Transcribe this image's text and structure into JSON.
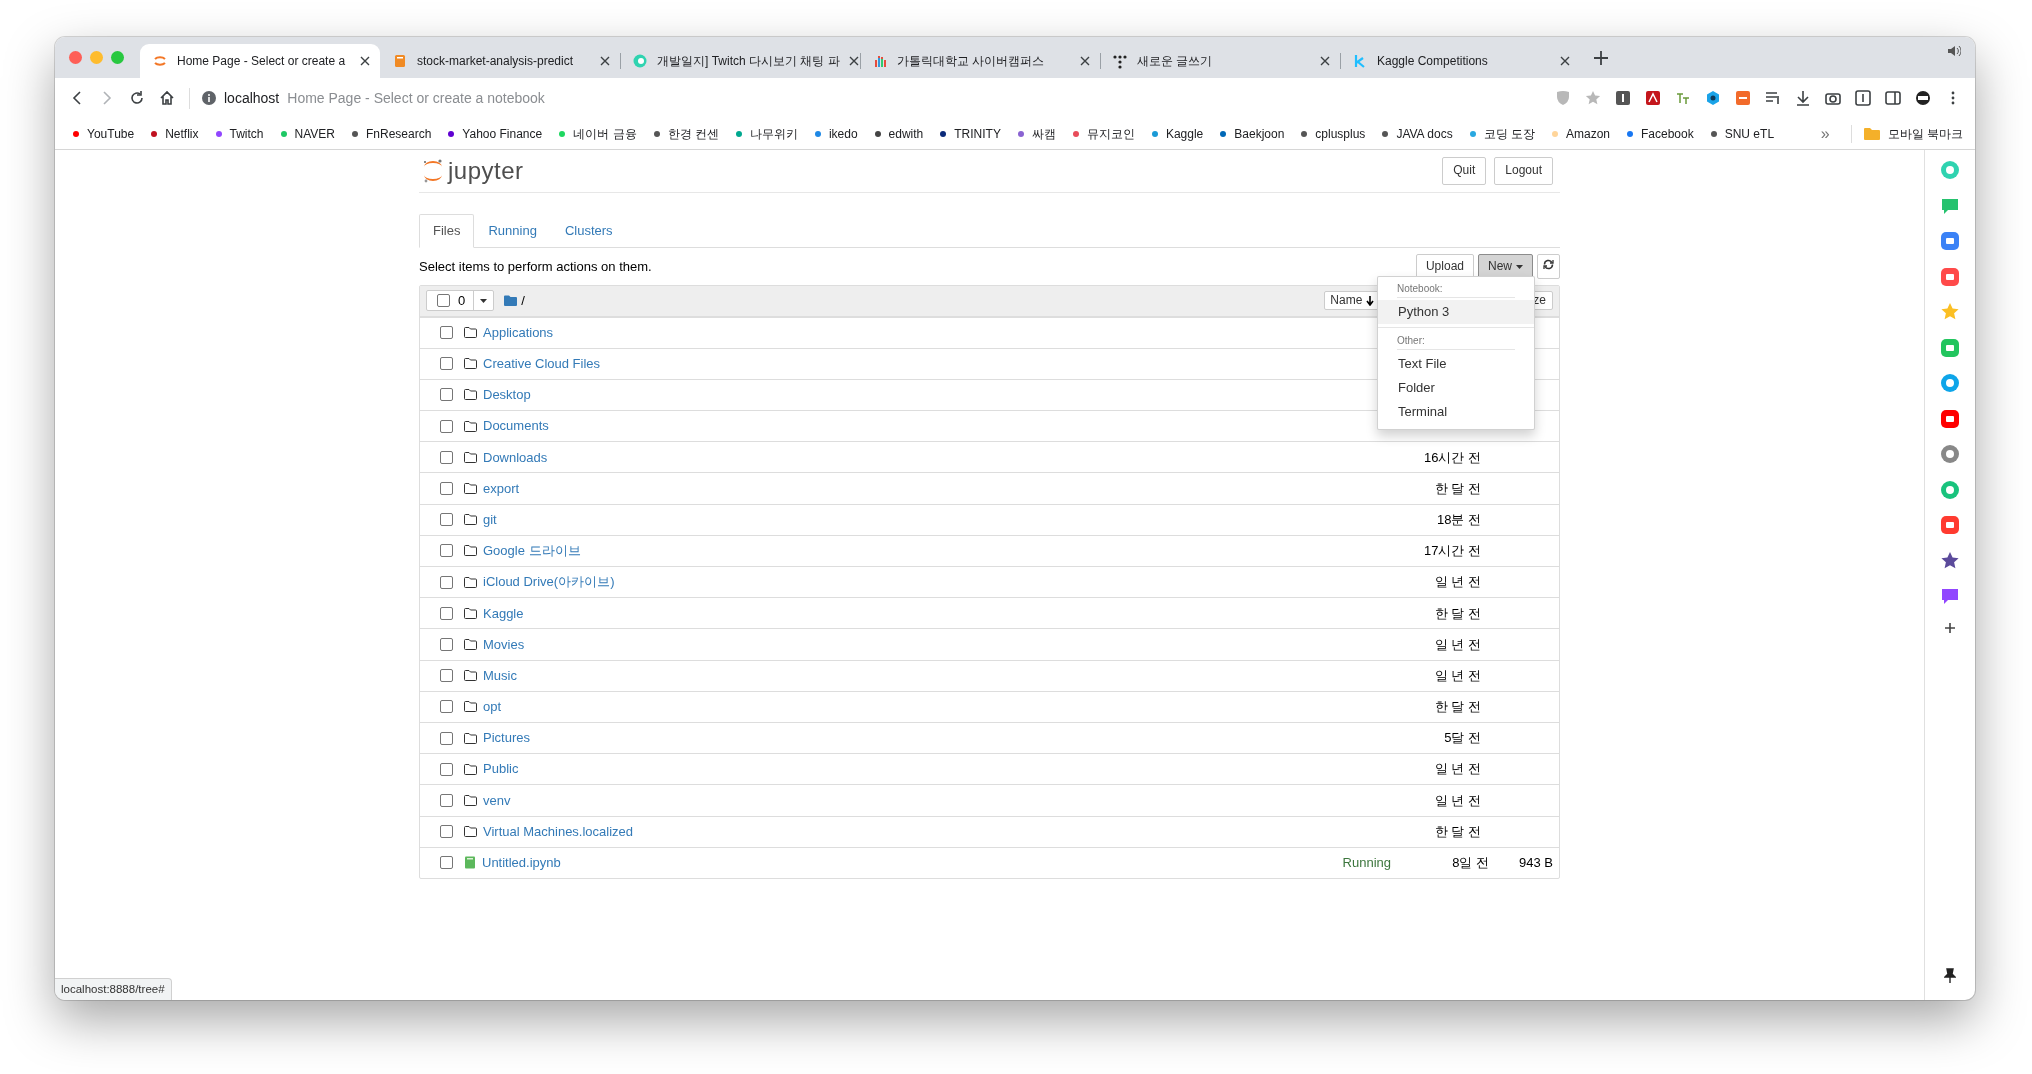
{
  "browser": {
    "tabs": [
      {
        "title": "Home Page - Select or create a",
        "selected": true
      },
      {
        "title": "stock-market-analysis-predict",
        "selected": false
      },
      {
        "title": "개발일지] Twitch 다시보기 채팅 파",
        "selected": false
      },
      {
        "title": "가톨릭대학교 사이버캠퍼스",
        "selected": false
      },
      {
        "title": "새로운 글쓰기",
        "selected": false
      },
      {
        "title": "Kaggle Competitions",
        "selected": false
      }
    ],
    "address": {
      "host": "localhost",
      "page_title": "Home Page - Select or create a notebook"
    },
    "bookmarks": [
      {
        "label": "YouTube",
        "color": "#ff0000"
      },
      {
        "label": "Netflix",
        "color": "#c0111f"
      },
      {
        "label": "Twitch",
        "color": "#9146ff"
      },
      {
        "label": "NAVER",
        "color": "#1ec865"
      },
      {
        "label": "FnResearch",
        "color": "#555555"
      },
      {
        "label": "Yahoo Finance",
        "color": "#6001d2"
      },
      {
        "label": "네이버 금융",
        "color": "#1ed760"
      },
      {
        "label": "한경 컨센",
        "color": "#555555"
      },
      {
        "label": "나무위키",
        "color": "#00a88f"
      },
      {
        "label": "ikedo",
        "color": "#1e88e5"
      },
      {
        "label": "edwith",
        "color": "#444444"
      },
      {
        "label": "TRINITY",
        "color": "#0b2a7a"
      },
      {
        "label": "싸캠",
        "color": "#8a63d2"
      },
      {
        "label": "뮤지코인",
        "color": "#e84c5a"
      },
      {
        "label": "Kaggle",
        "color": "#1a9ad6"
      },
      {
        "label": "Baekjoon",
        "color": "#0068b7"
      },
      {
        "label": "cplusplus",
        "color": "#555555"
      },
      {
        "label": "JAVA docs",
        "color": "#555555"
      },
      {
        "label": "코딩 도장",
        "color": "#29a8e0"
      },
      {
        "label": "Amazon",
        "color": "#ffd59a"
      },
      {
        "label": "Facebook",
        "color": "#1877f2"
      },
      {
        "label": "SNU eTL",
        "color": "#555555"
      }
    ],
    "bookmark_overflow": "»",
    "bookmark_folder": "모바일 북마크"
  },
  "jupyter": {
    "logo_text": "jupyter",
    "header_buttons": [
      "Quit",
      "Logout"
    ],
    "tabs": [
      {
        "label": "Files",
        "selected": true
      },
      {
        "label": "Running",
        "selected": false
      },
      {
        "label": "Clusters",
        "selected": false
      }
    ],
    "hint": "Select items to perform actions on them.",
    "upload_button": "Upload",
    "new_button": "New",
    "selection_count": "0",
    "path": "/",
    "sort_button": "Name",
    "column_3": "ze",
    "rows": [
      {
        "name": "Applications",
        "kind": "folder",
        "checked": false
      },
      {
        "name": "Creative Cloud Files",
        "kind": "folder",
        "checked": false
      },
      {
        "name": "Desktop",
        "kind": "folder",
        "checked": false
      },
      {
        "name": "Documents",
        "kind": "folder",
        "checked": false
      },
      {
        "name": "Downloads",
        "kind": "folder",
        "checked": false,
        "modified": "16시간 전"
      },
      {
        "name": "export",
        "kind": "folder",
        "checked": false,
        "modified": "한 달 전"
      },
      {
        "name": "git",
        "kind": "folder",
        "checked": false,
        "modified": "18분 전"
      },
      {
        "name": "Google 드라이브",
        "kind": "folder",
        "checked": false,
        "modified": "17시간 전"
      },
      {
        "name": "iCloud Drive(아카이브)",
        "kind": "folder",
        "checked": false,
        "modified": "일 년 전"
      },
      {
        "name": "Kaggle",
        "kind": "folder",
        "checked": false,
        "modified": "한 달 전"
      },
      {
        "name": "Movies",
        "kind": "folder",
        "checked": false,
        "modified": "일 년 전"
      },
      {
        "name": "Music",
        "kind": "folder",
        "checked": false,
        "modified": "일 년 전"
      },
      {
        "name": "opt",
        "kind": "folder",
        "checked": false,
        "modified": "한 달 전"
      },
      {
        "name": "Pictures",
        "kind": "folder",
        "checked": false,
        "modified": "5달 전"
      },
      {
        "name": "Public",
        "kind": "folder",
        "checked": false,
        "modified": "일 년 전"
      },
      {
        "name": "venv",
        "kind": "folder",
        "checked": false,
        "modified": "일 년 전"
      },
      {
        "name": "Virtual Machines.localized",
        "kind": "folder",
        "checked": false,
        "modified": "한 달 전"
      },
      {
        "name": "Untitled.ipynb",
        "kind": "notebook",
        "checked": false,
        "status": "Running",
        "modified": "8일 전",
        "size": "943 B"
      }
    ],
    "new_menu": {
      "sections": [
        {
          "heading": "Notebook:",
          "items": [
            {
              "label": "Python 3",
              "selected": true
            }
          ]
        },
        {
          "heading": "Other:",
          "items": [
            {
              "label": "Text File",
              "selected": false
            },
            {
              "label": "Folder",
              "selected": false
            },
            {
              "label": "Terminal",
              "selected": false
            }
          ]
        }
      ]
    }
  },
  "status_bar": "localhost:8888/tree#"
}
